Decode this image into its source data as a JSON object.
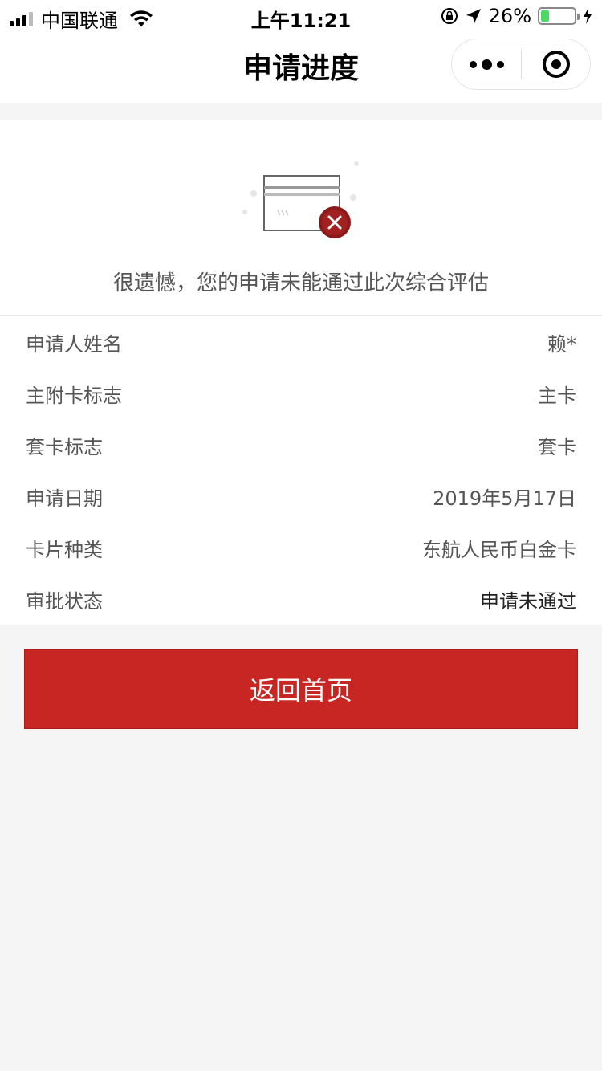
{
  "status_bar": {
    "carrier": "中国联通",
    "time": "上午11:21",
    "battery": "26%",
    "battery_level": 0.26
  },
  "nav": {
    "title": "申请进度"
  },
  "result": {
    "message": "很遗憾，您的申请未能通过此次综合评估"
  },
  "info": [
    {
      "label": "申请人姓名",
      "value": "赖*"
    },
    {
      "label": "主附卡标志",
      "value": "主卡"
    },
    {
      "label": "套卡标志",
      "value": "套卡"
    },
    {
      "label": "申请日期",
      "value": "2019年5月17日"
    },
    {
      "label": "卡片种类",
      "value": "东航人民币白金卡"
    },
    {
      "label": "审批状态",
      "value": "申请未通过"
    }
  ],
  "actions": {
    "home_label": "返回首页"
  },
  "colors": {
    "primary": "#c82623",
    "error_badge": "#8b1a1a",
    "background": "#f5f5f5"
  }
}
